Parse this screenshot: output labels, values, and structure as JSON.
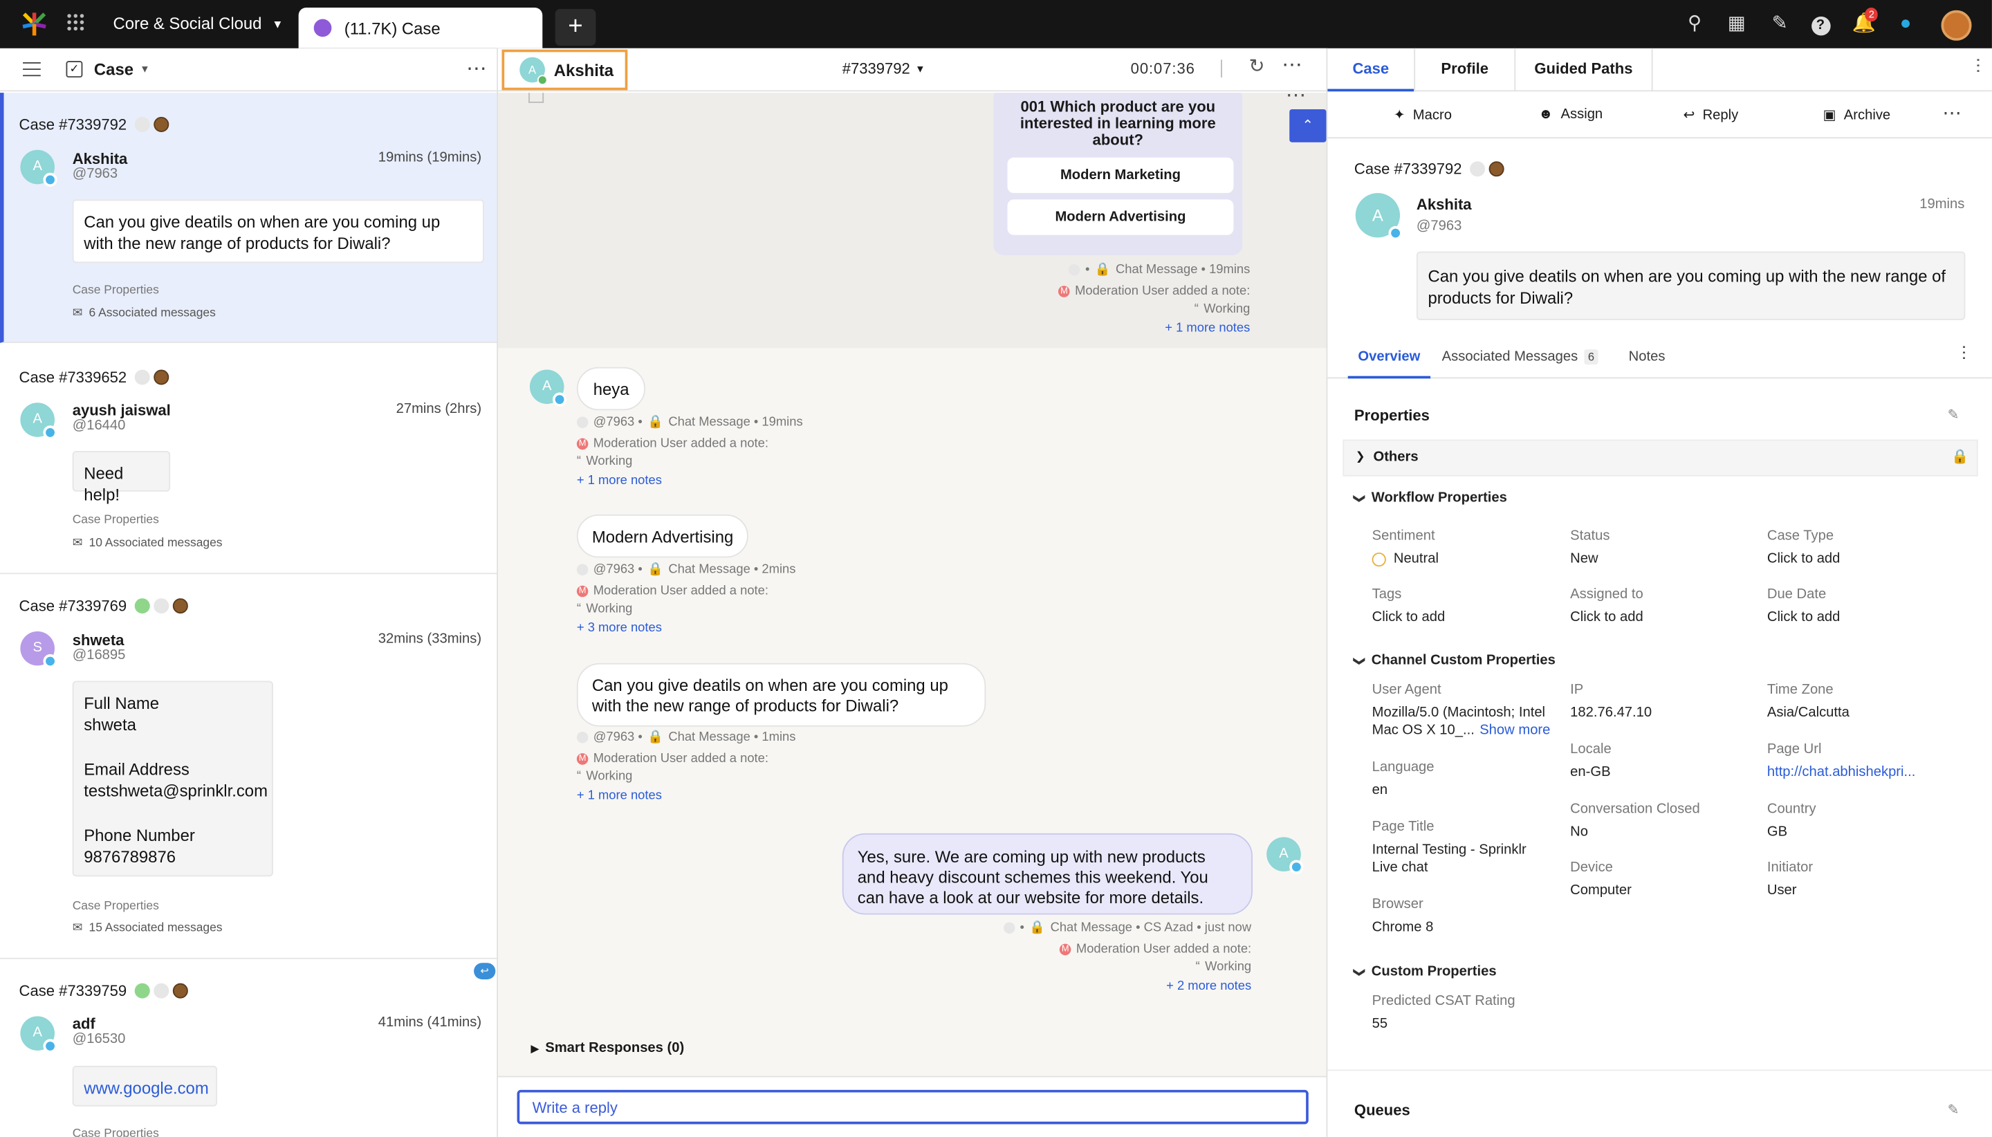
{
  "topbar": {
    "workspace": "Core & Social Cloud",
    "tab_label": "(11.7K) Case",
    "notif_count": "2"
  },
  "left": {
    "view_label": "Case",
    "cases": [
      {
        "id": "Case #7339792",
        "name": "Akshita",
        "handle": "@7963",
        "time": "19mins (19mins)",
        "message": "Can you give deatils on when are you coming up with the new range of products for Diwali?",
        "props": "Case Properties",
        "assoc": "6 Associated messages"
      },
      {
        "id": "Case #7339652",
        "name": "ayush jaiswal",
        "handle": "@16440",
        "time": "27mins (2hrs)",
        "message": "Need help!",
        "props": "Case Properties",
        "assoc": "10 Associated messages"
      },
      {
        "id": "Case #7339769",
        "name": "shweta",
        "handle": "@16895",
        "time": "32mins (33mins)",
        "message_lines": [
          "Full Name",
          "shweta",
          "",
          "Email Address",
          "testshweta@sprinklr.com",
          "",
          "Phone Number",
          "9876789876"
        ],
        "props": "Case Properties",
        "assoc": "15 Associated messages"
      },
      {
        "id": "Case #7339759",
        "name": "adf",
        "handle": "@16530",
        "time": "41mins (41mins)",
        "message": "www.google.com",
        "props": "Case Properties"
      }
    ]
  },
  "center": {
    "user_name": "Akshita",
    "case_number": "#7339792",
    "timer": "00:07:36",
    "bot_question": "001 Which product are you interested in learning more about?",
    "bot_options": [
      "Modern Marketing",
      "Modern Advertising"
    ],
    "bot_meta": "Chat Message • 19mins",
    "mod_note": "Moderation User added a note:",
    "working": "Working",
    "more_notes_1": "+ 1 more notes",
    "messages": [
      {
        "text": "heya",
        "meta": "@7963 • ",
        "meta2": "Chat Message • 19mins",
        "more": "+ 1 more notes"
      },
      {
        "text": "Modern Advertising",
        "meta": "@7963 • ",
        "meta2": "Chat Message • 2mins",
        "more": "+ 3 more notes"
      },
      {
        "text": "Can you give deatils on when are you coming up with the new range of products for Diwali?",
        "meta": "@7963 • ",
        "meta2": "Chat Message • 1mins",
        "more": "+ 1 more notes"
      }
    ],
    "agent_msg": "Yes, sure. We are coming up with new products and heavy discount schemes this weekend. You can have a look at our website for more details.",
    "agent_meta": "Chat Message • CS Azad • just now",
    "agent_more": "+ 2 more notes",
    "smart_responses": "Smart Responses (0)",
    "reply_placeholder": "Write a reply"
  },
  "right": {
    "tabs": [
      "Case",
      "Profile",
      "Guided Paths"
    ],
    "actions": [
      "Macro",
      "Assign",
      "Reply",
      "Archive"
    ],
    "case_id": "Case #7339792",
    "name": "Akshita",
    "handle": "@7963",
    "time": "19mins",
    "message": "Can you give deatils on when are you coming up with the new range of products for Diwali?",
    "subtabs": {
      "overview": "Overview",
      "assoc": "Associated Messages",
      "assoc_count": "6",
      "notes": "Notes"
    },
    "properties_title": "Properties",
    "others": "Others",
    "workflow": {
      "title": "Workflow Properties",
      "sentiment_l": "Sentiment",
      "sentiment_v": "Neutral",
      "status_l": "Status",
      "status_v": "New",
      "casetype_l": "Case Type",
      "casetype_v": "Click to add",
      "tags_l": "Tags",
      "tags_v": "Click to add",
      "assigned_l": "Assigned to",
      "assigned_v": "Click to add",
      "due_l": "Due Date",
      "due_v": "Click to add"
    },
    "channel": {
      "title": "Channel Custom Properties",
      "ua_l": "User Agent",
      "ua_v1": "Mozilla/5.0 (Macintosh; Intel",
      "ua_v2": "Mac OS X 10_...",
      "show_more": "Show more",
      "ip_l": "IP",
      "ip_v": "182.76.47.10",
      "tz_l": "Time Zone",
      "tz_v": "Asia/Calcutta",
      "locale_l": "Locale",
      "locale_v": "en-GB",
      "url_l": "Page Url",
      "url_v": "http://chat.abhishekpri...",
      "lang_l": "Language",
      "lang_v": "en",
      "conv_l": "Conversation Closed",
      "conv_v": "No",
      "country_l": "Country",
      "country_v": "GB",
      "title_l": "Page Title",
      "title_v1": "Internal Testing - Sprinklr",
      "title_v2": "Live chat",
      "device_l": "Device",
      "device_v": "Computer",
      "init_l": "Initiator",
      "init_v": "User",
      "browser_l": "Browser",
      "browser_v": "Chrome 8"
    },
    "custom": {
      "title": "Custom Properties",
      "csat_l": "Predicted CSAT Rating",
      "csat_v": "55"
    },
    "queues": "Queues"
  }
}
